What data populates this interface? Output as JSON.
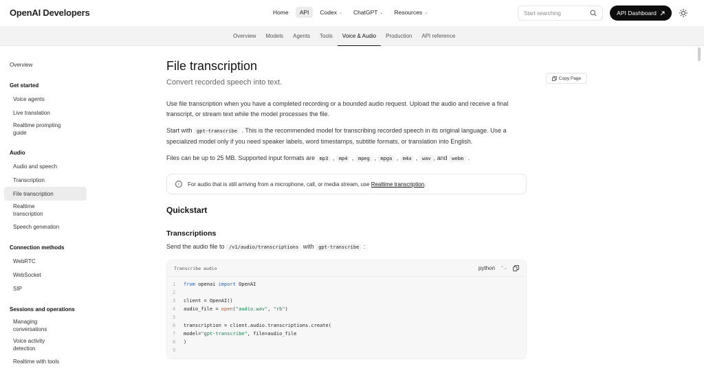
{
  "header": {
    "logo": "OpenAI Developers",
    "nav": [
      {
        "label": "Home",
        "chevron": false,
        "active": false
      },
      {
        "label": "API",
        "chevron": false,
        "active": true
      },
      {
        "label": "Codex",
        "chevron": true,
        "active": false
      },
      {
        "label": "ChatGPT",
        "chevron": true,
        "active": false
      },
      {
        "label": "Resources",
        "chevron": true,
        "active": false
      }
    ],
    "search_placeholder": "Start searching",
    "dashboard_label": "API Dashboard"
  },
  "subnav": {
    "tabs": [
      "Overview",
      "Models",
      "Agents",
      "Tools",
      "Voice & Audio",
      "Production",
      "API reference"
    ],
    "active": "Voice & Audio"
  },
  "sidebar": {
    "overview": "Overview",
    "sections": [
      {
        "heading": "Get started",
        "items": [
          "Voice agents",
          "Live translation",
          "Realtime prompting guide"
        ]
      },
      {
        "heading": "Audio",
        "items": [
          "Audio and speech",
          "Transcription",
          "File transcription",
          "Realtime transcription",
          "Speech generation"
        ]
      },
      {
        "heading": "Connection methods",
        "items": [
          "WebRTC",
          "WebSocket",
          "SIP"
        ]
      },
      {
        "heading": "Sessions and operations",
        "items": [
          "Managing conversations",
          "Voice activity detection",
          "Realtime with tools"
        ]
      }
    ],
    "active_item": "File transcription"
  },
  "page": {
    "title": "File transcription",
    "subtitle": "Convert recorded speech into text.",
    "copy_page": "Copy Page",
    "para1": "Use file transcription when you have a completed recording or a bounded audio request. Upload the audio and receive a final transcript, or stream text while the model processes the file.",
    "para2_pre": "Start with",
    "para2_code": "gpt-transcribe",
    "para2_post": ". This is the recommended model for transcribing recorded speech in its original language. Use a specialized model only if you need speaker labels, word timestamps, subtitle formats, or translation into English.",
    "para3_pre": "Files can be up to 25 MB. Supported input formats are",
    "formats": [
      "mp3",
      "mp4",
      "mpeg",
      "mpga",
      "m4a",
      "wav"
    ],
    "para3_and": ", and",
    "last_format": "webm",
    "note_text": "For audio that is still arriving from a microphone, call, or media stream, use",
    "note_link": "Realtime transcription",
    "quickstart": "Quickstart",
    "transcriptions": "Transcriptions",
    "send_pre": "Send the audio file to",
    "send_endpoint": "/v1/audio/transcriptions",
    "send_with": "with",
    "send_model": "gpt-transcribe",
    "code_title": "Transcribe audio",
    "code_lang": "python",
    "code_lines": [
      {
        "n": "1",
        "html": "<span class=\"kw\">from</span> openai <span class=\"kw\">import</span> OpenAI"
      },
      {
        "n": "2",
        "html": ""
      },
      {
        "n": "3",
        "html": "client = OpenAI()"
      },
      {
        "n": "4",
        "html": "audio_file = <span class=\"fn\">open</span>(<span class=\"str\">\"audio.wav\"</span>, <span class=\"str\">\"rb\"</span>)"
      },
      {
        "n": "5",
        "html": ""
      },
      {
        "n": "6",
        "html": "transcription = client.audio.transcriptions.create("
      },
      {
        "n": "7",
        "html": "    model=<span class=\"str\">\"gpt-transcribe\"</span>, file=audio_file"
      },
      {
        "n": "8",
        "html": ")"
      },
      {
        "n": "9",
        "html": ""
      }
    ]
  }
}
